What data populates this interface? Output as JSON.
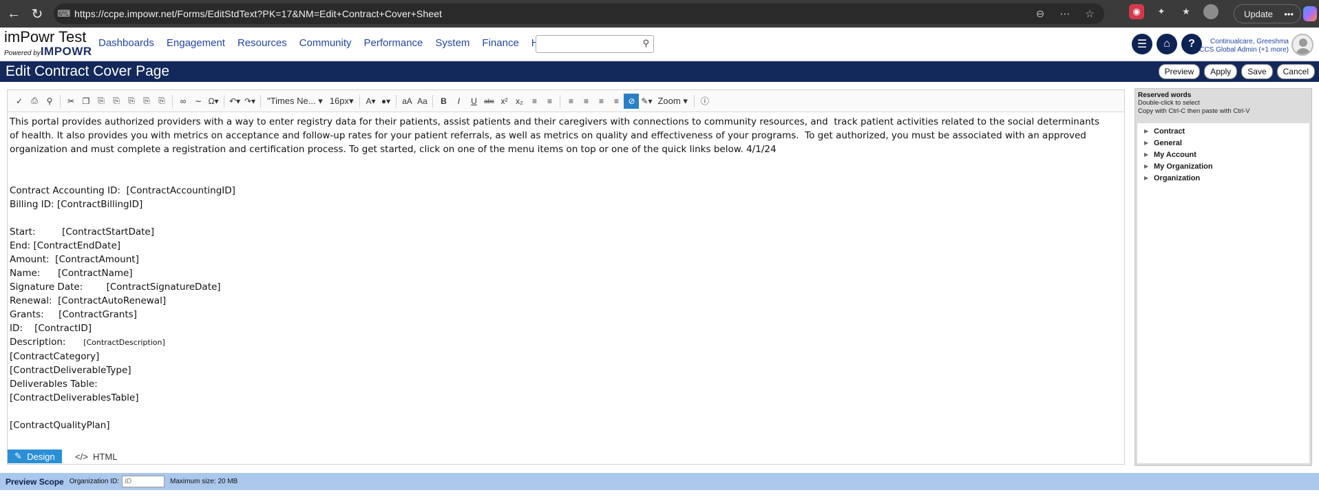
{
  "browser": {
    "url": "https://ccpe.impowr.net/Forms/EditStdText?PK=17&NM=Edit+Contract+Cover+Sheet",
    "update_label": "Update",
    "more_label": "•••"
  },
  "app": {
    "brand_title": "imPowr Test",
    "brand_powered": "Powered by",
    "brand_logo": "IMPOWR",
    "nav": [
      "Dashboards",
      "Engagement",
      "Resources",
      "Community",
      "Performance",
      "System",
      "Finance",
      "Help"
    ],
    "search_placeholder": "",
    "user_name": "Continualcare, Greeshma",
    "user_role": "CCS Global Admin (+1 more)"
  },
  "page": {
    "title": "Edit Contract Cover Page",
    "buttons": {
      "preview": "Preview",
      "apply": "Apply",
      "save": "Save",
      "cancel": "Cancel"
    }
  },
  "toolbar": {
    "font_family": "\"Times Ne...",
    "font_size": "16px",
    "zoom": "Zoom"
  },
  "editor": {
    "intro": "This portal provides authorized providers with a way to enter registry data for their patients, assist patients and their caregivers with connections to community resources, and  track patient activities related to the social determinants of health. It also provides you with metrics on acceptance and follow-up rates for your patient referrals, as well as metrics on quality and effectiveness of your programs.  To get authorized, you must be associated with an approved organization and must complete a registration and certification process. To get started, click on one of the menu items on top or one of the quick links below. 4/1/24",
    "lines": {
      "accounting": "Contract Accounting ID:  [ContractAccountingID]",
      "billing": "Billing ID: [ContractBillingID]",
      "start": "Start:         [ContractStartDate]",
      "end": "End: [ContractEndDate]",
      "amount": "Amount:  [ContractAmount]",
      "name": "Name:      [ContractName]",
      "signature": "Signature Date:        [ContractSignatureDate]",
      "renewal": "Renewal:  [ContractAutoRenewal]",
      "grants": "Grants:     [ContractGrants]",
      "id": "ID:    [ContractID]",
      "description_label": "Description:      ",
      "description_value": "[ContractDescription]",
      "category": "[ContractCategory]",
      "deliverable_type": "[ContractDeliverableType]",
      "deliverables_label": "Deliverables Table:",
      "deliverables_table": "[ContractDeliverablesTable]",
      "quality_plan": "[ContractQualityPlan]"
    },
    "mode_design": "Design",
    "mode_html": "HTML"
  },
  "reserved": {
    "heading": "Reserved words",
    "help1": "Double-click to select",
    "help2": "Copy with Ctrl-C then paste with Ctrl-V",
    "items": [
      "Contract",
      "General",
      "My Account",
      "My Organization",
      "Organization"
    ]
  },
  "scope": {
    "label": "Preview Scope",
    "org_label": "Organization ID:",
    "org_placeholder": "ID",
    "max_size": "Maximum size: 20 MB"
  }
}
